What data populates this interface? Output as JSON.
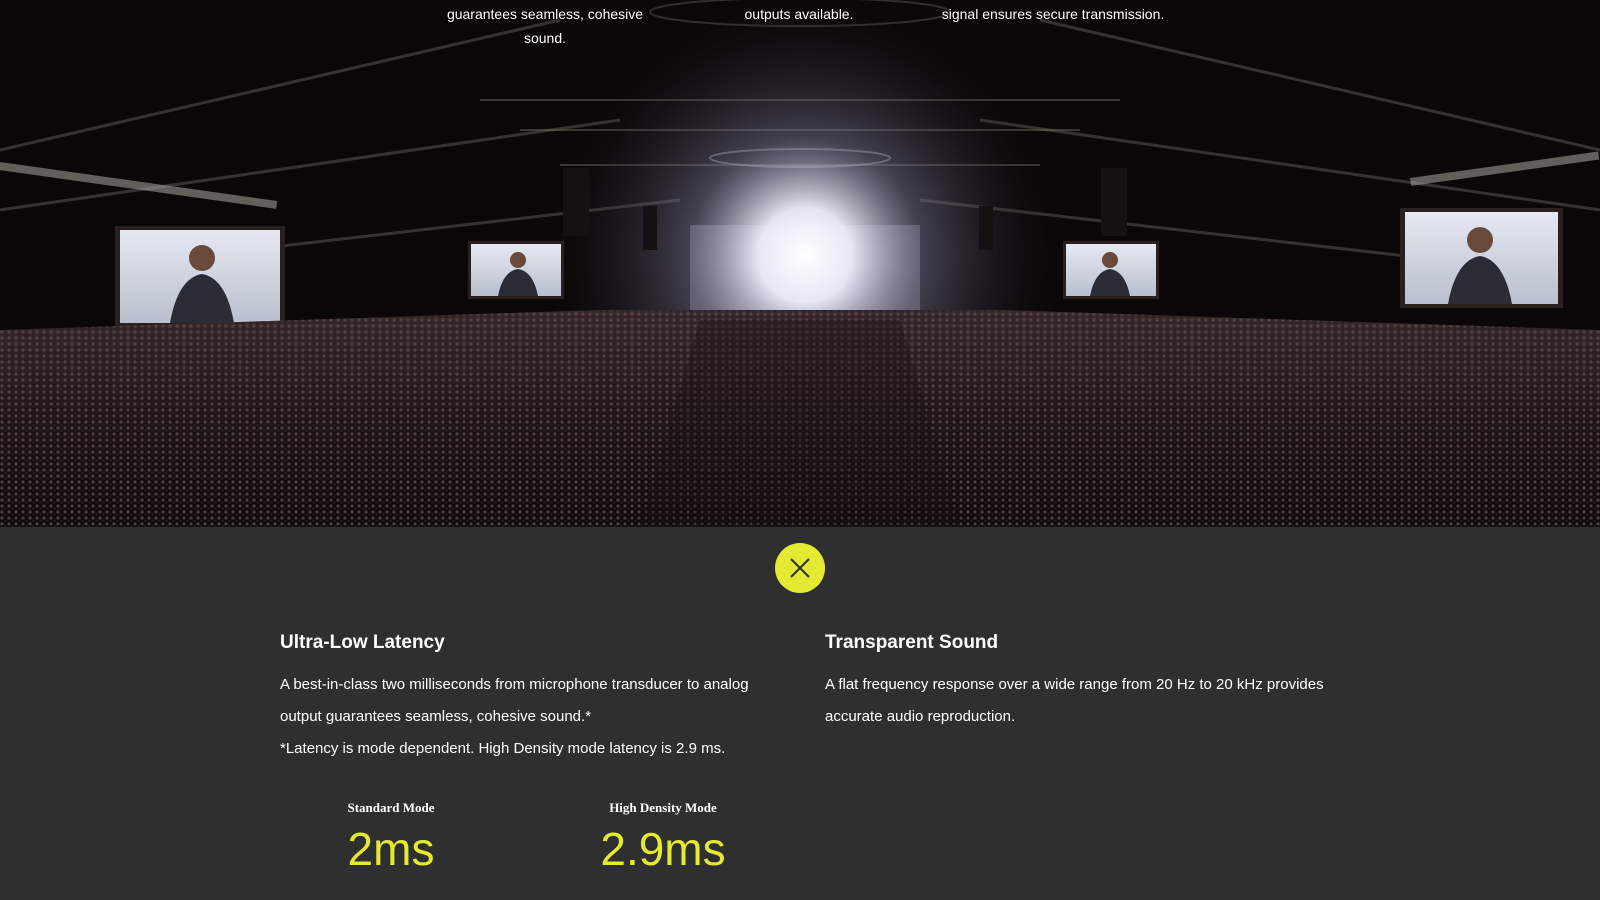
{
  "hero": {
    "captions": [
      "guarantees seamless, cohesive sound.",
      "outputs available.",
      "signal ensures secure transmission."
    ]
  },
  "close_button": {
    "icon": "close-icon",
    "color": "#e4e932"
  },
  "features": {
    "latency": {
      "title": "Ultra-Low Latency",
      "line1": "A best-in-class two milliseconds from microphone transducer to analog output guarantees seamless, cohesive sound.*",
      "line2": "*Latency is mode dependent. High Density mode latency is 2.9 ms."
    },
    "sound": {
      "title": "Transparent Sound",
      "line1": "A flat frequency response over a wide range from 20 Hz to 20 kHz provides accurate audio reproduction."
    }
  },
  "stats": [
    {
      "label": "Standard Mode",
      "value": "2ms"
    },
    {
      "label": "High Density Mode",
      "value": "2.9ms"
    }
  ],
  "colors": {
    "accent": "#e4e932",
    "panel_bg": "#2f2f2f"
  }
}
